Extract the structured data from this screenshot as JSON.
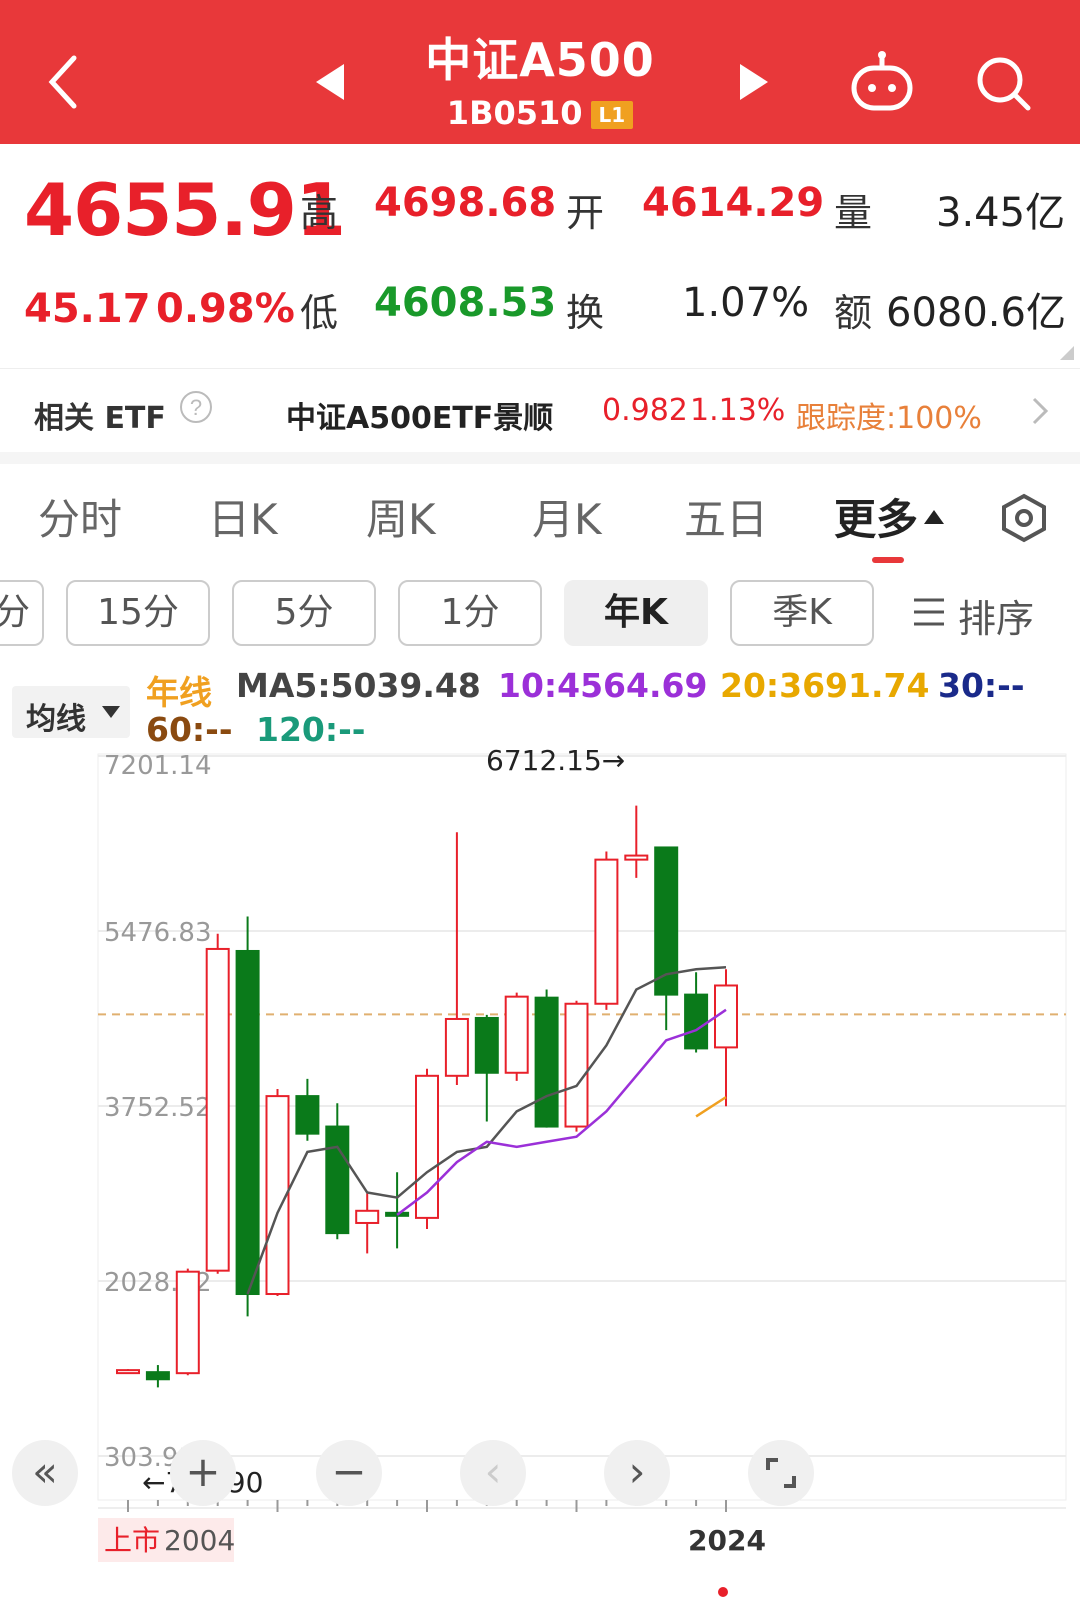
{
  "header": {
    "title": "中证A500",
    "code": "1B0510",
    "level_badge": "L1",
    "icons": [
      "back-chevron-icon",
      "prev-triangle-icon",
      "next-triangle-icon",
      "robot-icon",
      "search-icon"
    ]
  },
  "quote": {
    "price": "4655.91",
    "change": "45.17",
    "change_pct": "0.98%",
    "high_label": "高",
    "high": "4698.68",
    "open_label": "开",
    "open": "4614.29",
    "volume_label": "量",
    "volume": "3.45亿",
    "low_label": "低",
    "low": "4608.53",
    "turnover_label": "换",
    "turnover": "1.07%",
    "amount_label": "额",
    "amount": "6080.6亿"
  },
  "etf": {
    "label": "相关 ETF",
    "name": "中证A500ETF景顺",
    "price": "0.982",
    "pct": "1.13%",
    "tracking": "跟踪度:100%"
  },
  "tabs": [
    "分时",
    "日K",
    "周K",
    "月K",
    "五日",
    "更多"
  ],
  "active_tab": "更多",
  "periods": [
    "分",
    "15分",
    "5分",
    "1分",
    "年K",
    "季K"
  ],
  "active_period": "年K",
  "sort_label": "排序",
  "ma": {
    "selector": "均线",
    "line_type": "年线",
    "ma5": "MA5:5039.48",
    "ma10": "10:4564.69",
    "ma20": "20:3691.74",
    "ma30": "30:--",
    "ma60": "60:--",
    "ma120": "120:--"
  },
  "colors": {
    "up": "#e8202a",
    "down": "#0a7a1a",
    "brand": "#e8383a"
  },
  "chart_data": {
    "type": "candlestick",
    "y_ticks": [
      "7201.14",
      "5476.83",
      "3752.52",
      "2028.22",
      "303.91"
    ],
    "ylim": [
      303.91,
      7201.14
    ],
    "x_labels": [
      "上市",
      "2004",
      "2024"
    ],
    "max_annotation": "6712.15→",
    "min_annotation": "←792.90",
    "candles": [
      {
        "o": 1130,
        "h": 1160,
        "l": 1120,
        "c": 1150
      },
      {
        "o": 1130,
        "h": 1200,
        "l": 980,
        "c": 1060
      },
      {
        "o": 1120,
        "h": 2150,
        "l": 1100,
        "c": 2120
      },
      {
        "o": 2130,
        "h": 5450,
        "l": 2100,
        "c": 5300
      },
      {
        "o": 5280,
        "h": 5620,
        "l": 1680,
        "c": 1900
      },
      {
        "o": 1900,
        "h": 3920,
        "l": 1880,
        "c": 3850
      },
      {
        "o": 3850,
        "h": 4020,
        "l": 3410,
        "c": 3480
      },
      {
        "o": 3550,
        "h": 3780,
        "l": 2440,
        "c": 2500
      },
      {
        "o": 2600,
        "h": 2890,
        "l": 2300,
        "c": 2720
      },
      {
        "o": 2700,
        "h": 3100,
        "l": 2350,
        "c": 2680
      },
      {
        "o": 2650,
        "h": 4120,
        "l": 2540,
        "c": 4050
      },
      {
        "o": 4050,
        "h": 6450,
        "l": 3960,
        "c": 4610
      },
      {
        "o": 4620,
        "h": 4650,
        "l": 3600,
        "c": 4080
      },
      {
        "o": 4080,
        "h": 4870,
        "l": 4000,
        "c": 4830
      },
      {
        "o": 4820,
        "h": 4900,
        "l": 3540,
        "c": 3550
      },
      {
        "o": 3550,
        "h": 4790,
        "l": 3500,
        "c": 4760
      },
      {
        "o": 4760,
        "h": 6260,
        "l": 4700,
        "c": 6180
      },
      {
        "o": 6180,
        "h": 6712.15,
        "l": 6000,
        "c": 6220
      },
      {
        "o": 6300,
        "h": 6300,
        "l": 4500,
        "c": 4850
      },
      {
        "o": 4850,
        "h": 5070,
        "l": 4280,
        "c": 4320
      },
      {
        "o": 4330,
        "h": 5100,
        "l": 3750,
        "c": 4940
      }
    ],
    "ma5": [
      null,
      null,
      null,
      null,
      1900,
      2700,
      3300,
      3350,
      2900,
      2850,
      3100,
      3300,
      3350,
      3700,
      3850,
      3950,
      4350,
      4900,
      5050,
      5100,
      5120
    ],
    "ma10": [
      null,
      null,
      null,
      null,
      null,
      null,
      null,
      null,
      null,
      2680,
      2900,
      3200,
      3400,
      3350,
      3400,
      3450,
      3700,
      4050,
      4400,
      4500,
      4700
    ],
    "ma20": [
      null,
      null,
      null,
      null,
      null,
      null,
      null,
      null,
      null,
      null,
      null,
      null,
      null,
      null,
      null,
      null,
      null,
      null,
      null,
      3650,
      3840
    ]
  },
  "controls": [
    "collapse-icon",
    "zoom-in-icon",
    "zoom-out-icon",
    "pan-left-icon",
    "pan-right-icon",
    "fullscreen-icon"
  ]
}
